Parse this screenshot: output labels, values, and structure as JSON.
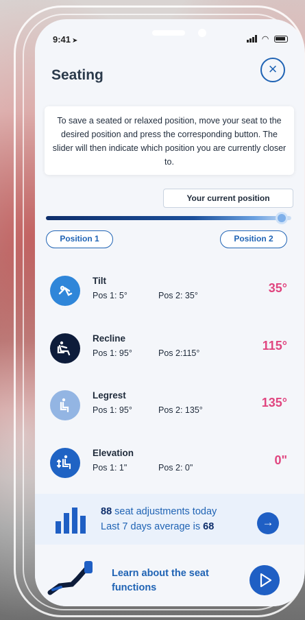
{
  "status": {
    "time": "9:41"
  },
  "header": {
    "title": "Seating",
    "close_label": "×"
  },
  "info": {
    "text": "To save a seated or relaxed position, move your seat to the desired position and press the corresponding button. The slider will then indicate which position you are currently closer to."
  },
  "slider": {
    "current_label": "Your current position",
    "pos1_label": "Position 1",
    "pos2_label": "Position 2",
    "value": 0.96
  },
  "rows": [
    {
      "name": "Tilt",
      "pos1": "Pos 1: 5°",
      "pos2": "Pos 2: 35°",
      "value": "35°",
      "icon": "tilt-icon"
    },
    {
      "name": "Recline",
      "pos1": "Pos 1: 95°",
      "pos2": "Pos 2:115°",
      "value": "115°",
      "icon": "recline-icon"
    },
    {
      "name": "Legrest",
      "pos1": "Pos 1: 95°",
      "pos2": "Pos 2: 135°",
      "value": "135°",
      "icon": "legrest-icon"
    },
    {
      "name": "Elevation",
      "pos1": "Pos 1: 1\"",
      "pos2": "Pos 2: 0\"",
      "value": "0\"",
      "icon": "elevation-icon"
    }
  ],
  "stats": {
    "count": "88",
    "line1_rest": " seat adjustments today",
    "line2_prefix": "Last 7 days average is ",
    "average": "68"
  },
  "learn": {
    "text": "Learn about the seat functions"
  },
  "colors": {
    "accent": "#1f63b4",
    "value": "#e0457f",
    "navy": "#0e2e6b"
  }
}
